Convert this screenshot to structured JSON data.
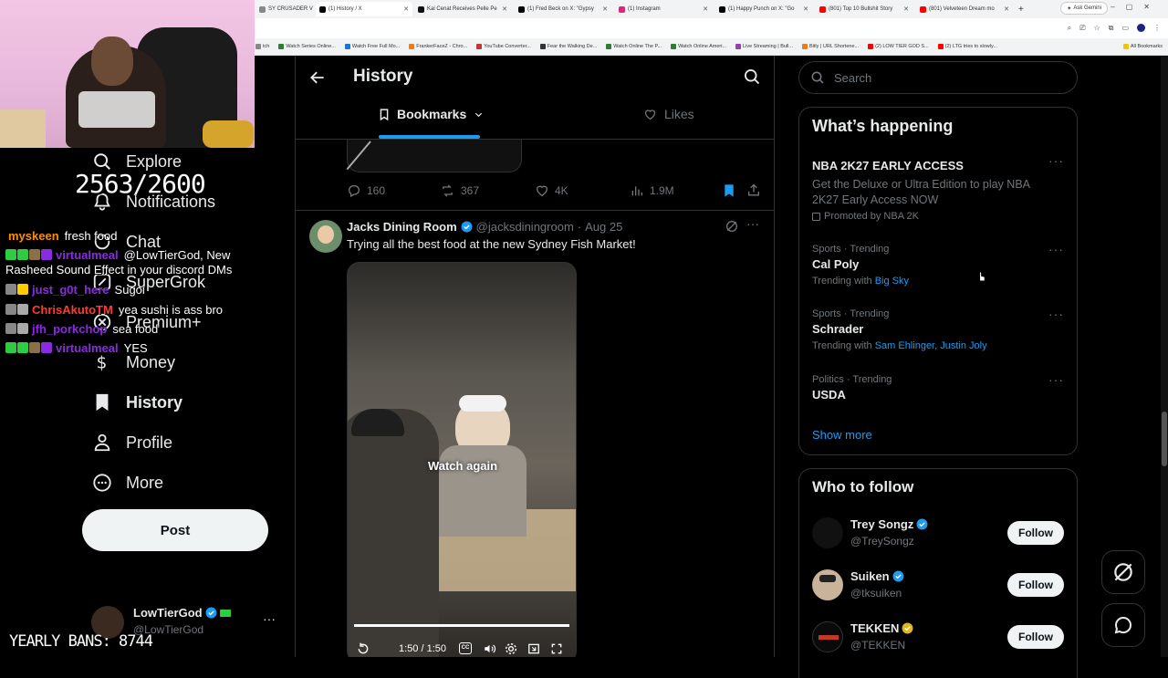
{
  "browser": {
    "tabs": [
      {
        "label": "SY CRUSADER V",
        "color": "#888"
      },
      {
        "label": "(1) History / X",
        "color": "#000"
      },
      {
        "label": "Kai Cenat Receives Pelle Pe",
        "color": "#111"
      },
      {
        "label": "(1) Fred Beck on X: \"Gypsy",
        "color": "#000"
      },
      {
        "label": "(1) Instagram",
        "color": "#d62976"
      },
      {
        "label": "(1) Happy Punch on X: \"Go",
        "color": "#000"
      },
      {
        "label": "(801) Top 10 Bullshit Story",
        "color": "#ff0000"
      },
      {
        "label": "(801) Velveteen Dream mo",
        "color": "#ff0000"
      }
    ],
    "ask_gemini": "Ask Gemini",
    "bookmarks": [
      "tch",
      "Watch Series Online...",
      "Watch Free Full Mo...",
      "FrankerFaceZ - Chro...",
      "YouTube Converter...",
      "Fear the Walking De...",
      "Watch Online The P...",
      "Watch Online Ameri...",
      "Live Streaming | Bull...",
      "Bitly | URL Shortene...",
      "(2) LOW TIER GOD S...",
      "(2) LTG tries to slowly...",
      "All Bookmarks"
    ]
  },
  "overlay": {
    "follower_goal": "2563/2600",
    "yearly_bans": "YEARLY BANS: 8744",
    "chat": [
      {
        "user": "myskeen",
        "user_color": "#ff8c00",
        "msg": "fresh food",
        "badges": []
      },
      {
        "user": "virtualmeal",
        "user_color": "#8a2be2",
        "msg": "@LowTierGod, New",
        "badges": [
          "#2ecc40",
          "#2ecc40",
          "#8b6f47",
          "#8a2be2"
        ]
      },
      {
        "user": "",
        "user_color": "#fff",
        "msg": "Rasheed Sound Effect in your discord DMs",
        "badges": []
      },
      {
        "user": "just_g0t_here",
        "user_color": "#8a2be2",
        "msg": "Sugoi",
        "badges": [
          "#888",
          "#ffcc00"
        ]
      },
      {
        "user": "ChrisAkutoTM",
        "user_color": "#ff3b30",
        "msg": "yea sushi is ass bro",
        "badges": [
          "#888",
          "#aaa"
        ]
      },
      {
        "user": "jfh_porkchop",
        "user_color": "#8a2be2",
        "msg": "sea food",
        "badges": [
          "#888",
          "#aaa"
        ]
      },
      {
        "user": "virtualmeal",
        "user_color": "#8a2be2",
        "msg": "YES",
        "badges": [
          "#2ecc40",
          "#2ecc40",
          "#8b6f47",
          "#8a2be2"
        ]
      }
    ]
  },
  "nav": {
    "items": [
      {
        "label": "Explore",
        "icon": "search-icon"
      },
      {
        "label": "Notifications",
        "icon": "bell-icon"
      },
      {
        "label": "Chat",
        "icon": "chat-icon"
      },
      {
        "label": "SuperGrok",
        "icon": "grok-icon"
      },
      {
        "label": "Premium+",
        "icon": "x-premium-icon"
      },
      {
        "label": "Money",
        "icon": "dollar-icon"
      },
      {
        "label": "History",
        "icon": "bookmark-icon"
      },
      {
        "label": "Profile",
        "icon": "person-icon"
      },
      {
        "label": "More",
        "icon": "more-circle-icon"
      }
    ],
    "post_label": "Post",
    "account": {
      "name": "LowTierGod",
      "handle": "@LowTierGod"
    }
  },
  "center": {
    "title": "History",
    "tabs": [
      {
        "label": "Bookmarks",
        "active": true
      },
      {
        "label": "Likes",
        "active": false
      }
    ],
    "prev_tweet_stats": {
      "replies": "160",
      "reposts": "367",
      "likes": "4K",
      "views": "1.9M"
    },
    "tweet": {
      "author": "Jacks Dining Room",
      "handle": "@jacksdiningroom",
      "date": "Aug 25",
      "text": "Trying all the best food at the new Sydney Fish Market!",
      "video_overlay": "Watch again",
      "video_time": "1:50 / 1:50",
      "video_progress": 1.0
    }
  },
  "right": {
    "search_placeholder": "Search",
    "whats_happening": {
      "title": "What’s happening",
      "promo": {
        "name": "NBA 2K27 EARLY ACCESS",
        "desc": "Get the Deluxe or Ultra Edition to play NBA 2K27 Early Access NOW",
        "promoted": "Promoted by NBA 2K"
      },
      "trends": [
        {
          "meta": "Sports · Trending",
          "name": "Cal Poly",
          "with_label": "Trending with",
          "with": "Big Sky"
        },
        {
          "meta": "Sports · Trending",
          "name": "Schrader",
          "with_label": "Trending with",
          "with": "Sam Ehlinger, Justin Joly"
        },
        {
          "meta": "Politics · Trending",
          "name": "USDA",
          "with_label": "",
          "with": ""
        }
      ],
      "show_more": "Show more"
    },
    "who_to_follow": {
      "title": "Who to follow",
      "accounts": [
        {
          "name": "Trey Songz",
          "handle": "@TreySongz",
          "badge": "#1d9bf0"
        },
        {
          "name": "Suiken",
          "handle": "@tksuiken",
          "badge": "#1d9bf0"
        },
        {
          "name": "TEKKEN",
          "handle": "@TEKKEN",
          "badge": "#e2b719"
        }
      ],
      "follow_label": "Follow"
    }
  },
  "colors": {
    "accent": "#1d9bf0",
    "bg": "#000000",
    "muted": "#71767b",
    "border": "#2f3336"
  }
}
